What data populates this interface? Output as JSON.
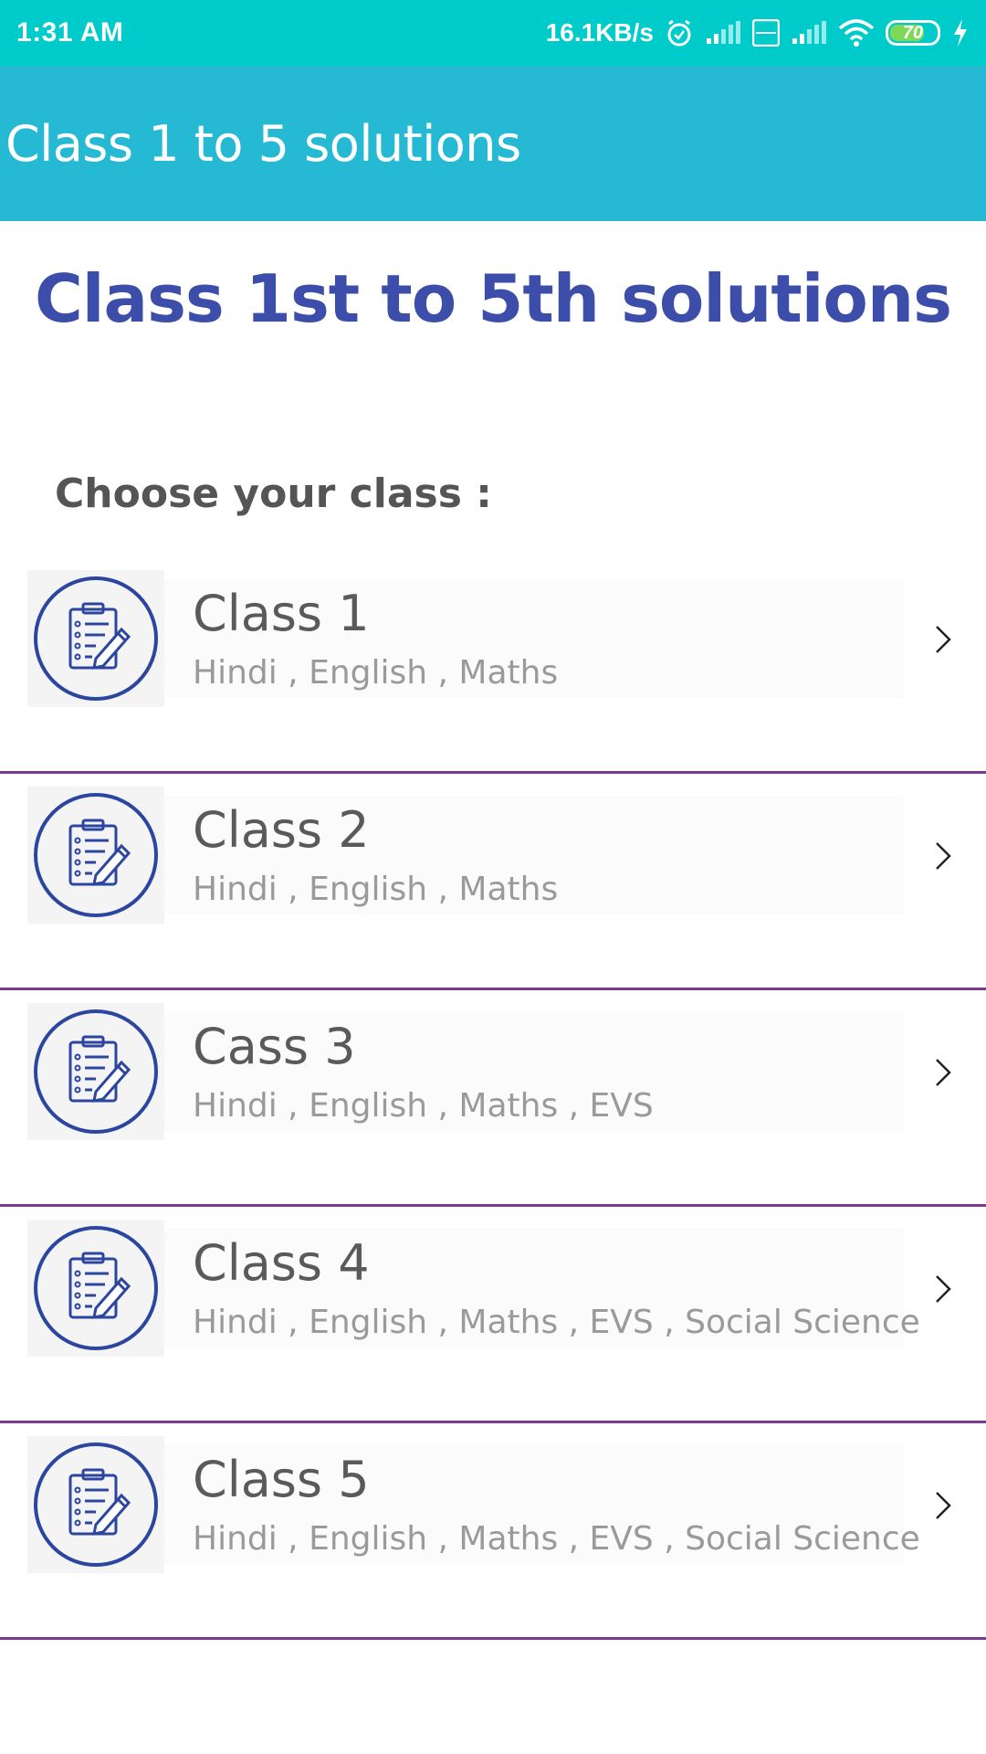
{
  "status_bar": {
    "time": "1:31 AM",
    "speed": "16.1KB/s",
    "battery": "70",
    "icons": [
      "alarm-icon",
      "signal-icon",
      "volte-icon",
      "signal-icon",
      "wifi-icon",
      "battery-icon",
      "charging-icon"
    ]
  },
  "app_bar": {
    "title": "Class 1 to 5 solutions"
  },
  "main": {
    "heading": "Class 1st to 5th  solutions",
    "choose_label": "Choose your class :",
    "items": [
      {
        "title": "Class 1",
        "subjects": "Hindi , English , Maths"
      },
      {
        "title": "Class 2",
        "subjects": "Hindi , English , Maths"
      },
      {
        "title": "Cass 3",
        "subjects": "Hindi , English , Maths , EVS"
      },
      {
        "title": "Class 4",
        "subjects": "Hindi , English , Maths , EVS , Social Science"
      },
      {
        "title": "Class 5",
        "subjects": "Hindi , English , Maths , EVS , Social Science"
      }
    ]
  },
  "colors": {
    "status_bar": "#00cbcb",
    "app_bar": "#25b9d3",
    "heading": "#3d4eaa",
    "divider": "#7b3a8f",
    "icon_blue": "#2c46a0"
  }
}
